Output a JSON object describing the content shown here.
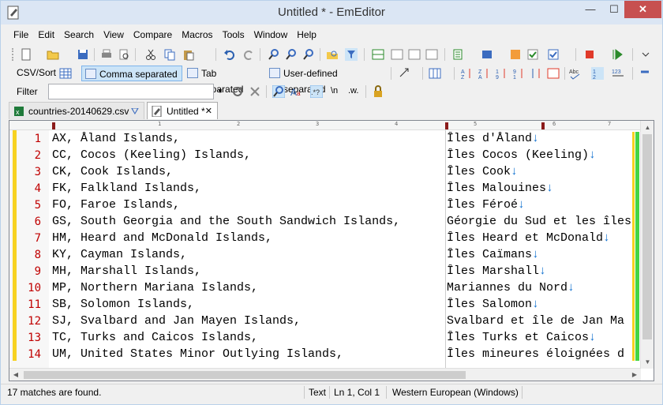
{
  "window": {
    "title": "Untitled * - EmEditor",
    "minimize": "—",
    "maximize": "☐",
    "close": "✕"
  },
  "menu": [
    "File",
    "Edit",
    "Search",
    "View",
    "Compare",
    "Macros",
    "Tools",
    "Window",
    "Help"
  ],
  "csv_toolbar": {
    "label": "CSV/Sort",
    "comma": "Comma separated",
    "tab": "Tab separated",
    "user": "User-defined separated"
  },
  "filter_toolbar": {
    "label": "Filter",
    "value": "",
    "regex_n": "\\n",
    "w": ".w."
  },
  "tabs": [
    {
      "label": "countries-20140629.csv"
    },
    {
      "label": "Untitled *"
    }
  ],
  "ruler_labels": [
    "1",
    "2",
    "3",
    "4",
    "5",
    "6",
    "7"
  ],
  "lines": [
    {
      "num": "1",
      "left": "AX, Åland Islands,",
      "right": "Îles d'Åland"
    },
    {
      "num": "2",
      "left": "CC, Cocos (Keeling) Islands,",
      "right": "Îles Cocos (Keeling)"
    },
    {
      "num": "3",
      "left": "CK, Cook Islands,",
      "right": "Îles Cook"
    },
    {
      "num": "4",
      "left": "FK, Falkland Islands,",
      "right": "Îles Malouines"
    },
    {
      "num": "5",
      "left": "FO, Faroe Islands,",
      "right": "Îles Féroé"
    },
    {
      "num": "6",
      "left": "GS, South Georgia and the South Sandwich Islands,",
      "right": "Géorgie du Sud et les îles"
    },
    {
      "num": "7",
      "left": "HM, Heard and McDonald Islands,",
      "right": "Îles Heard et McDonald"
    },
    {
      "num": "8",
      "left": "KY, Cayman Islands,",
      "right": "Îles Caïmans"
    },
    {
      "num": "9",
      "left": "MH, Marshall Islands,",
      "right": "Îles Marshall"
    },
    {
      "num": "10",
      "left": "MP, Northern Mariana Islands,",
      "right": "Mariannes du Nord"
    },
    {
      "num": "11",
      "left": "SB, Solomon Islands,",
      "right": "Îles Salomon"
    },
    {
      "num": "12",
      "left": "SJ, Svalbard and Jan Mayen Islands,",
      "right": "Svalbard et île de Jan Ma"
    },
    {
      "num": "13",
      "left": "TC, Turks and Caicos Islands,",
      "right": "Îles Turks et Caicos"
    },
    {
      "num": "14",
      "left": "UM, United States Minor Outlying Islands,",
      "right": "Îles mineures éloignées d"
    }
  ],
  "line_end_arrows": [
    true,
    true,
    true,
    true,
    true,
    false,
    true,
    true,
    true,
    true,
    true,
    false,
    true,
    false
  ],
  "status": {
    "message": "17 matches are found.",
    "mode": "Text",
    "position": "Ln 1, Col 1",
    "encoding": "Western European (Windows)"
  },
  "colors": {
    "line_number": "#c00000",
    "bookmark_bar": "#f7d220",
    "green_bar": "#44d444",
    "arrow": "#1070d0"
  }
}
